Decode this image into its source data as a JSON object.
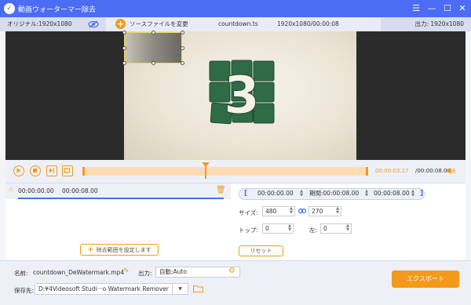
{
  "app": {
    "title": "動画ウォーターマー除去"
  },
  "infobar": {
    "original_label": "オリジナル:1920x1080",
    "source_change": "ソースファイルを変更",
    "filename": "countdown.ts",
    "file_info": "1920x1080/00:00:08",
    "output_label": "出力: 1920x1080"
  },
  "preview": {
    "overlay_digit": "3"
  },
  "timeline": {
    "current_time": "00:00:03.17",
    "total_time": "/00:00:08.00",
    "progress": 0.43
  },
  "segments": [
    {
      "start": "00:00:00.00",
      "end": "00:00:08.00"
    }
  ],
  "left_panel": {
    "add_range_label": "除去範囲を設定します"
  },
  "right_panel": {
    "start_time": "00:00:00.00",
    "duration_label": "期間:00:00:08.00",
    "end_time": "00:00:08.00",
    "size_label": "サイズ:",
    "width": "480",
    "height": "270",
    "top_label": "トップ:",
    "top_value": "0",
    "left_label": "左:",
    "left_value": "0",
    "reset_label": "リセット"
  },
  "bottom": {
    "name_label": "名前:",
    "name_value": "countdown_DeWatermark.mp4",
    "output_label": "出力:",
    "output_value": "自動;Auto",
    "save_label": "保存先:",
    "save_path": "D:¥4Videosoft Studi···o Watermark Remover",
    "export_label": "エクスポート"
  },
  "colors": {
    "accent": "#f39a1b",
    "primary": "#4b6cf3"
  }
}
